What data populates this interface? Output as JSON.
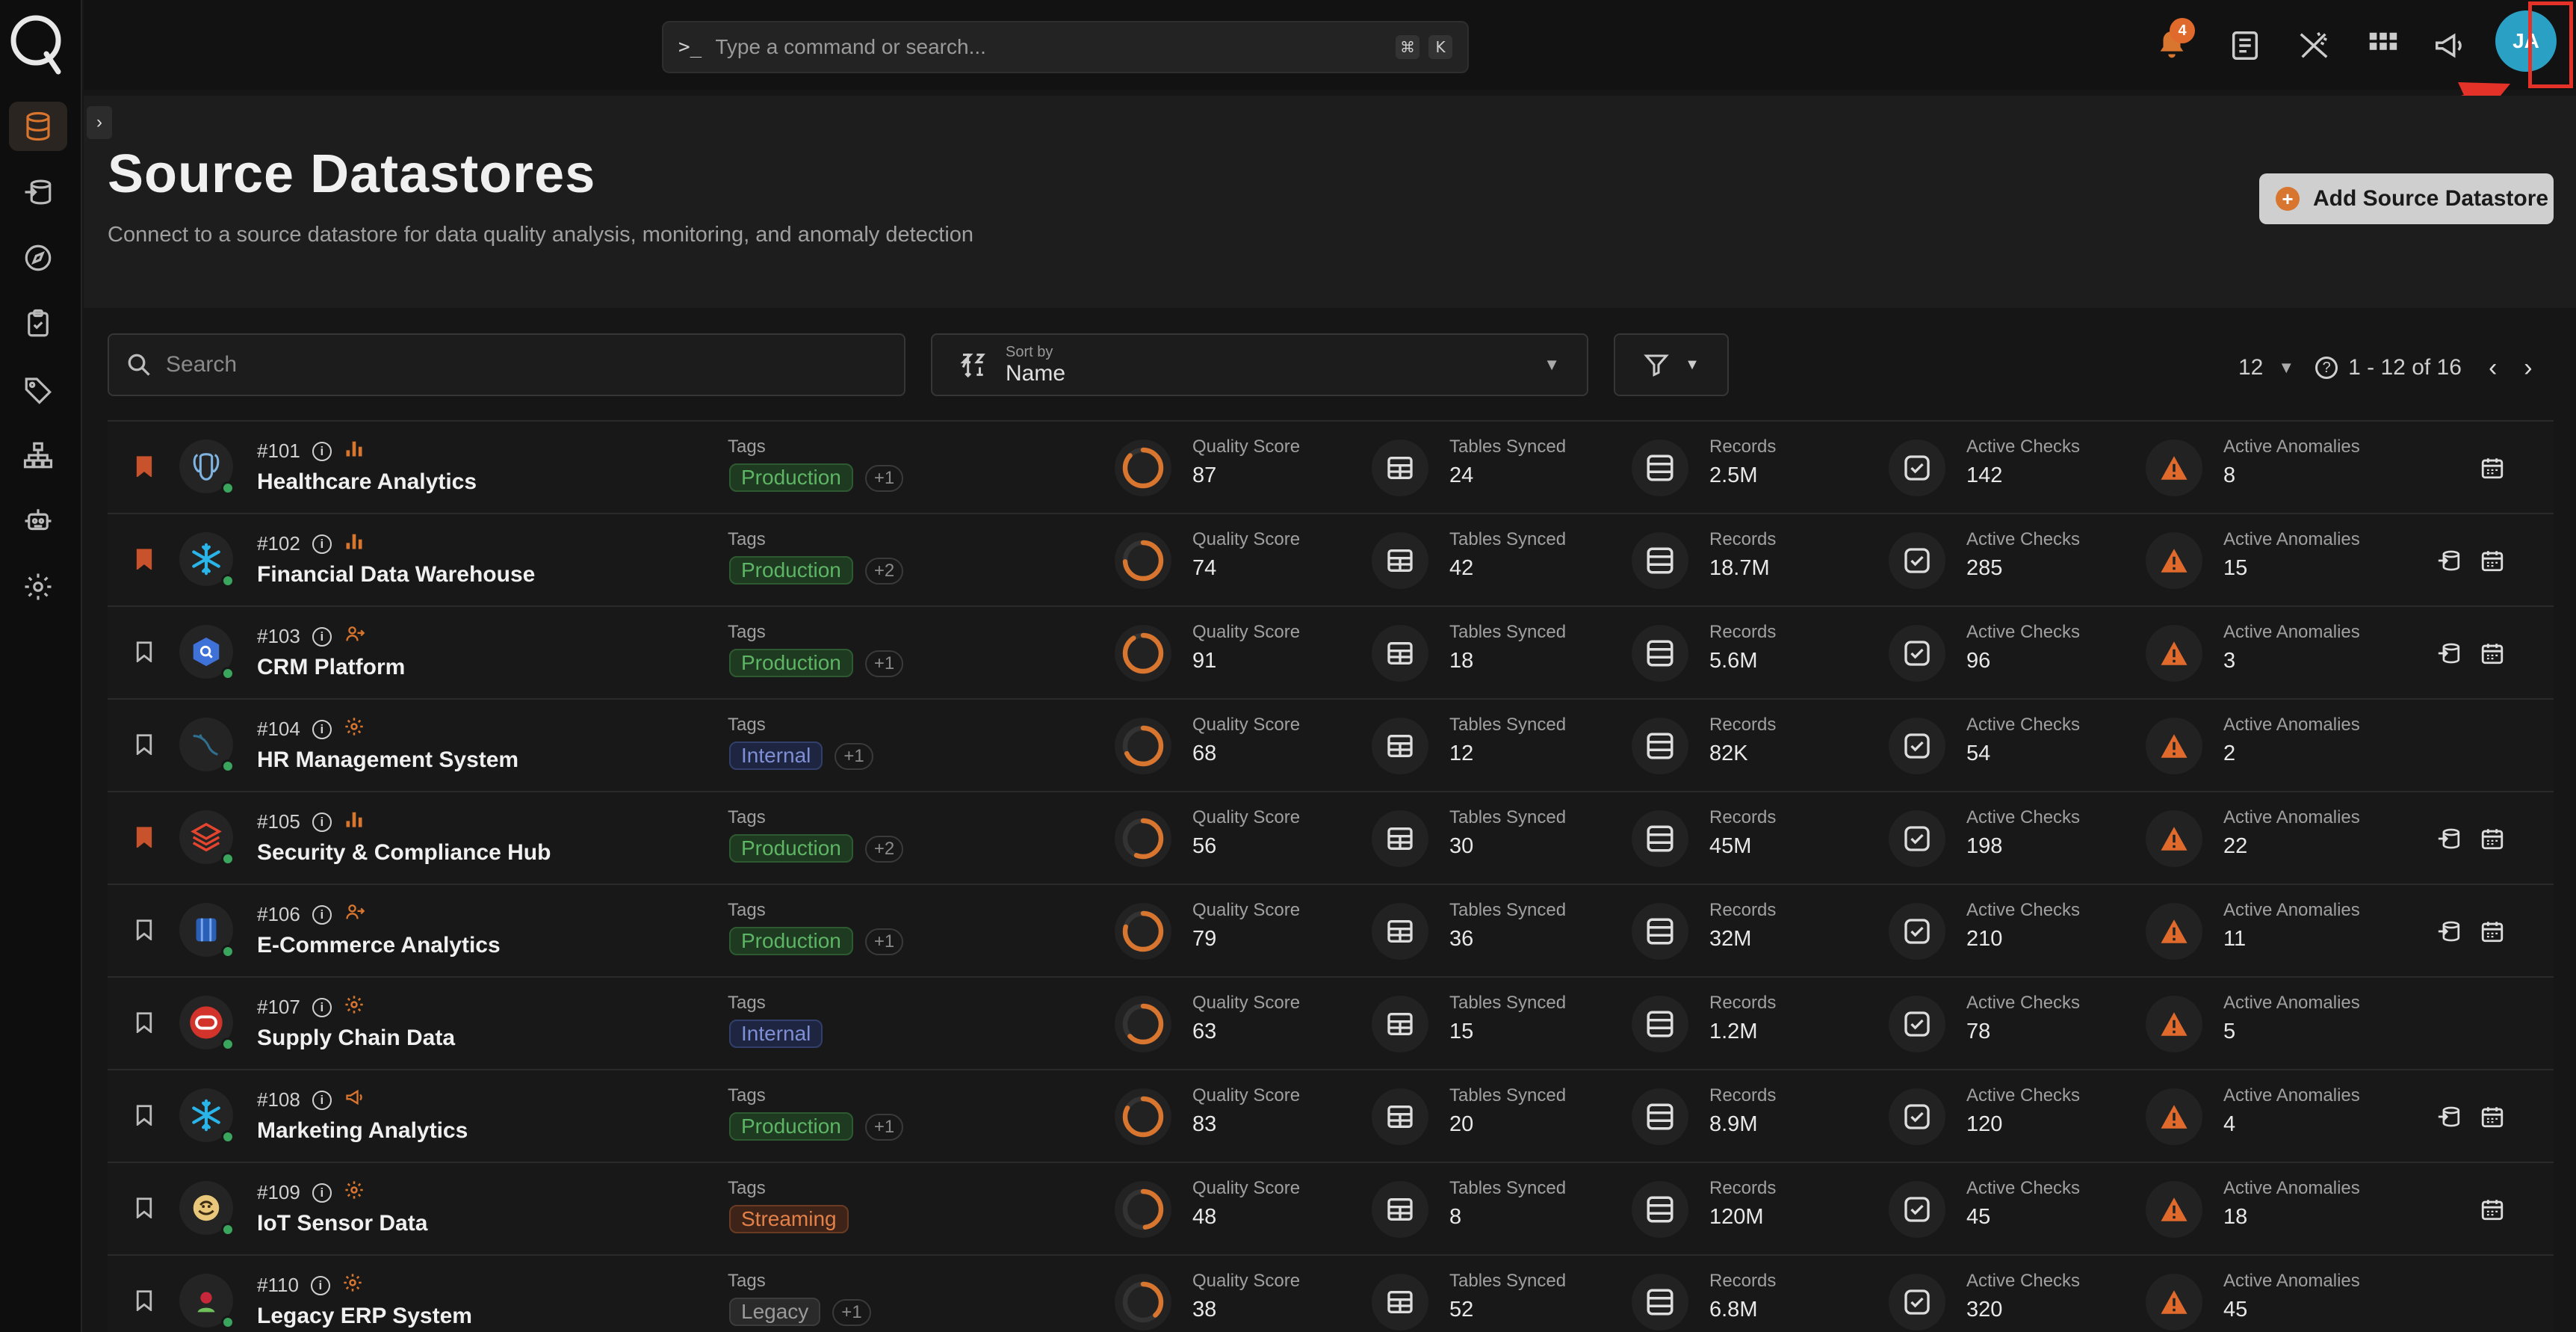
{
  "topbar": {
    "search_placeholder": "Type a command or search...",
    "shortcut_keys": [
      "⌘",
      "K"
    ],
    "notification_count": "4",
    "avatar_initials": "JA"
  },
  "header": {
    "title": "Source Datastores",
    "subtitle": "Connect to a source datastore for data quality analysis, monitoring, and anomaly detection",
    "add_button": "Add Source Datastore"
  },
  "toolbar": {
    "search_placeholder": "Search",
    "sort_caption": "Sort by",
    "sort_value": "Name",
    "page_size": "12",
    "range": "1 - 12 of 16"
  },
  "metric_labels": {
    "quality": "Quality Score",
    "tables": "Tables Synced",
    "records": "Records",
    "checks": "Active Checks",
    "anomalies": "Active Anomalies",
    "tags": "Tags"
  },
  "colors": {
    "accent": "#d8752e",
    "success": "#3aa55d",
    "highlight": "#e53228",
    "avatar": "#2ba0c5"
  },
  "rows": [
    {
      "id": "#101",
      "name": "Healthcare Analytics",
      "type_icon": "chart-icon",
      "bookmarked": true,
      "logo": "postgres",
      "tag": "Production",
      "tag_kind": "production",
      "more": "+1",
      "quality": "87",
      "tables": "24",
      "records": "2.5M",
      "checks": "142",
      "anomalies": "8",
      "actions": [
        "calendar-icon"
      ]
    },
    {
      "id": "#102",
      "name": "Financial Data Warehouse",
      "type_icon": "chart-icon",
      "bookmarked": true,
      "logo": "snowflake",
      "tag": "Production",
      "tag_kind": "production",
      "more": "+2",
      "quality": "74",
      "tables": "42",
      "records": "18.7M",
      "checks": "285",
      "anomalies": "15",
      "actions": [
        "enrichment-icon",
        "calendar-icon"
      ]
    },
    {
      "id": "#103",
      "name": "CRM Platform",
      "type_icon": "user-icon",
      "bookmarked": false,
      "logo": "bigquery",
      "tag": "Production",
      "tag_kind": "production",
      "more": "+1",
      "quality": "91",
      "tables": "18",
      "records": "5.6M",
      "checks": "96",
      "anomalies": "3",
      "actions": [
        "enrichment-icon",
        "calendar-icon"
      ]
    },
    {
      "id": "#104",
      "name": "HR Management System",
      "type_icon": "gear-icon",
      "bookmarked": false,
      "logo": "mysql",
      "tag": "Internal",
      "tag_kind": "internal",
      "more": "+1",
      "quality": "68",
      "tables": "12",
      "records": "82K",
      "checks": "54",
      "anomalies": "2",
      "actions": []
    },
    {
      "id": "#105",
      "name": "Security & Compliance Hub",
      "type_icon": "chart-icon",
      "bookmarked": true,
      "logo": "databricks",
      "tag": "Production",
      "tag_kind": "production",
      "more": "+2",
      "quality": "56",
      "tables": "30",
      "records": "45M",
      "checks": "198",
      "anomalies": "22",
      "actions": [
        "enrichment-icon",
        "calendar-icon"
      ]
    },
    {
      "id": "#106",
      "name": "E-Commerce Analytics",
      "type_icon": "user-icon",
      "bookmarked": false,
      "logo": "redshift",
      "tag": "Production",
      "tag_kind": "production",
      "more": "+1",
      "quality": "79",
      "tables": "36",
      "records": "32M",
      "checks": "210",
      "anomalies": "11",
      "actions": [
        "enrichment-icon",
        "calendar-icon"
      ]
    },
    {
      "id": "#107",
      "name": "Supply Chain Data",
      "type_icon": "gear-icon",
      "bookmarked": false,
      "logo": "oracle",
      "tag": "Internal",
      "tag_kind": "internal",
      "more": "",
      "quality": "63",
      "tables": "15",
      "records": "1.2M",
      "checks": "78",
      "anomalies": "5",
      "actions": []
    },
    {
      "id": "#108",
      "name": "Marketing Analytics",
      "type_icon": "megaphone-icon",
      "bookmarked": false,
      "logo": "snowflake",
      "tag": "Production",
      "tag_kind": "production",
      "more": "+1",
      "quality": "83",
      "tables": "20",
      "records": "8.9M",
      "checks": "120",
      "anomalies": "4",
      "actions": [
        "enrichment-icon",
        "calendar-icon"
      ]
    },
    {
      "id": "#109",
      "name": "IoT Sensor Data",
      "type_icon": "gear-icon",
      "bookmarked": false,
      "logo": "hive",
      "tag": "Streaming",
      "tag_kind": "streaming",
      "more": "",
      "quality": "48",
      "tables": "8",
      "records": "120M",
      "checks": "45",
      "anomalies": "18",
      "actions": [
        "calendar-icon"
      ]
    },
    {
      "id": "#110",
      "name": "Legacy ERP System",
      "type_icon": "gear-icon",
      "bookmarked": false,
      "logo": "db2",
      "tag": "Legacy",
      "tag_kind": "legacy",
      "more": "+1",
      "quality": "38",
      "tables": "52",
      "records": "6.8M",
      "checks": "320",
      "anomalies": "45",
      "actions": []
    }
  ]
}
